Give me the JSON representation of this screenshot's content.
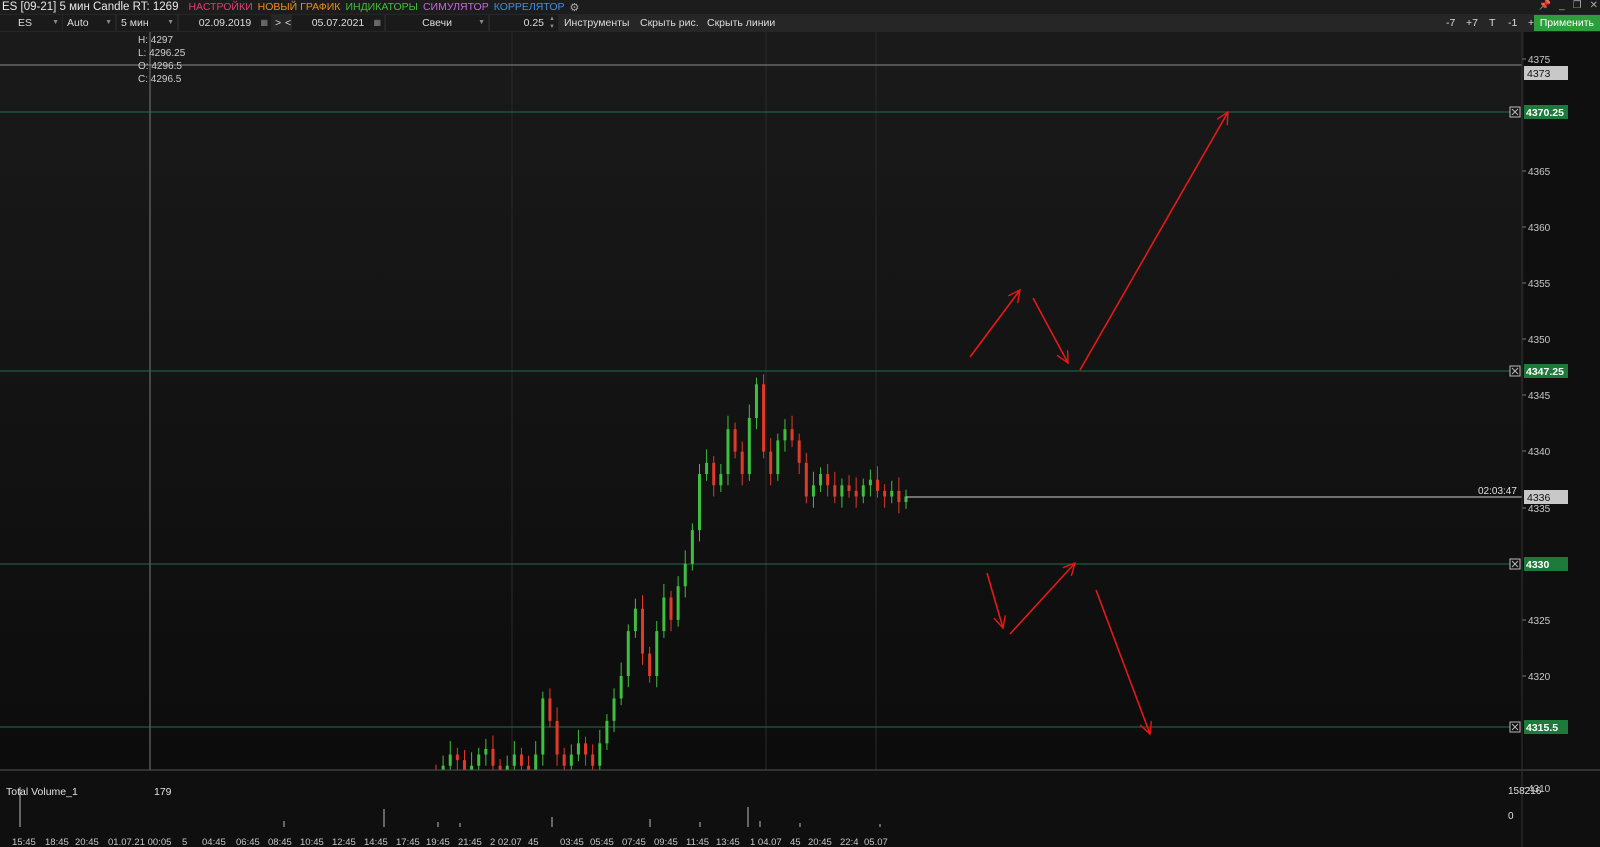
{
  "window": {
    "title": "ES [09-21] 5 мин Candle RT: 1269",
    "menu": [
      {
        "label": "НАСТРОЙКИ",
        "color": "#e8396e"
      },
      {
        "label": "НОВЫЙ ГРАФИК",
        "color": "#f08a1c"
      },
      {
        "label": "ИНДИКАТОРЫ",
        "color": "#3fbf3f"
      },
      {
        "label": "СИМУЛЯТОР",
        "color": "#c56ad8"
      },
      {
        "label": "КОРРЕЛЯТОР",
        "color": "#3f8fe0"
      }
    ],
    "settings_icon": "gear-icon",
    "controls": [
      "pin-icon",
      "minimize-icon",
      "restore-icon",
      "close-icon"
    ]
  },
  "toolbar": {
    "symbol": "ES",
    "scale": "Auto",
    "interval": "5 мин",
    "date_from": "02.09.2019",
    "nav_next": ">",
    "nav_prev": "<",
    "date_to": "05.07.2021",
    "chart_type": "Свечи",
    "step": "0.25",
    "instruments": "Инструменты",
    "hide_drawings": "Скрыть рис.",
    "hide_lines": "Скрыть линии",
    "m7": "-7",
    "p7": "+7",
    "t": "T",
    "m1": "-1",
    "p1": "+1",
    "apply": "Применить"
  },
  "ohlc": {
    "h": "H: 4297",
    "l": "L: 4296.25",
    "o": "O: 4296.5",
    "c": "C: 4296.5"
  },
  "price_axis": {
    "ticks": [
      "4375",
      "4370",
      "4365",
      "4360",
      "4355",
      "4350",
      "4345",
      "4340",
      "4335",
      "4325",
      "4320",
      "4310"
    ],
    "current_price": "4336",
    "countdown": "02:03:47",
    "crosshair_price": "4373"
  },
  "levels": [
    "4370.25",
    "4347.25",
    "4330",
    "4315.5"
  ],
  "volume": {
    "label": "Total Volume_1",
    "value": "179",
    "max": "158216",
    "zero": "0"
  },
  "time_axis": [
    "15:45",
    "18:45",
    "20:45",
    "01.07.21 00:05",
    "5",
    "04:45",
    "06:45",
    "08:45",
    "10:45",
    "12:45",
    "14:45",
    "17:45",
    "19:45",
    "21:45",
    "2 02.07",
    "45",
    "03:45",
    "05:45",
    "07:45",
    "09:45",
    "11:45",
    "13:45",
    "1 04.07",
    "45",
    "20:45",
    "22:4",
    "05.07"
  ],
  "colors": {
    "up": "#3fbf3f",
    "down": "#e03a2a",
    "level": "#1f6e4a",
    "level_label": "#1d7a3a",
    "arrow": "#e81818",
    "bg": "#0f0f0f"
  },
  "chart_data": {
    "type": "candlestick",
    "ylim": [
      4309,
      4378
    ],
    "close_path": [
      4311,
      4312,
      4313,
      4312.5,
      4311.5,
      4312,
      4313,
      4313.5,
      4312,
      4311,
      4312,
      4313,
      4312,
      4311.5,
      4313,
      4318,
      4316,
      4313,
      4312,
      4313,
      4314,
      4313,
      4312,
      4314,
      4316,
      4318,
      4320,
      4324,
      4326,
      4322,
      4320,
      4324,
      4327,
      4325,
      4328,
      4330,
      4333,
      4338,
      4339,
      4337,
      4338,
      4342,
      4340,
      4338,
      4343,
      4346,
      4340,
      4338,
      4341,
      4342,
      4341,
      4339,
      4336,
      4337,
      4338,
      4337,
      4336,
      4337,
      4336.5,
      4336,
      4337,
      4337.5,
      4336.5,
      4336,
      4336.5,
      4335.5,
      4336
    ]
  },
  "drawings": {
    "arrows": [
      {
        "from": [
          970,
          357
        ],
        "to": [
          1020,
          290
        ]
      },
      {
        "from": [
          1033,
          298
        ],
        "to": [
          1068,
          363
        ]
      },
      {
        "from": [
          1080,
          370
        ],
        "to": [
          1228,
          112
        ]
      },
      {
        "from": [
          987,
          573
        ],
        "to": [
          1003,
          628
        ]
      },
      {
        "from": [
          1010,
          634
        ],
        "to": [
          1075,
          563
        ]
      },
      {
        "from": [
          1096,
          590
        ],
        "to": [
          1150,
          734
        ]
      }
    ]
  }
}
